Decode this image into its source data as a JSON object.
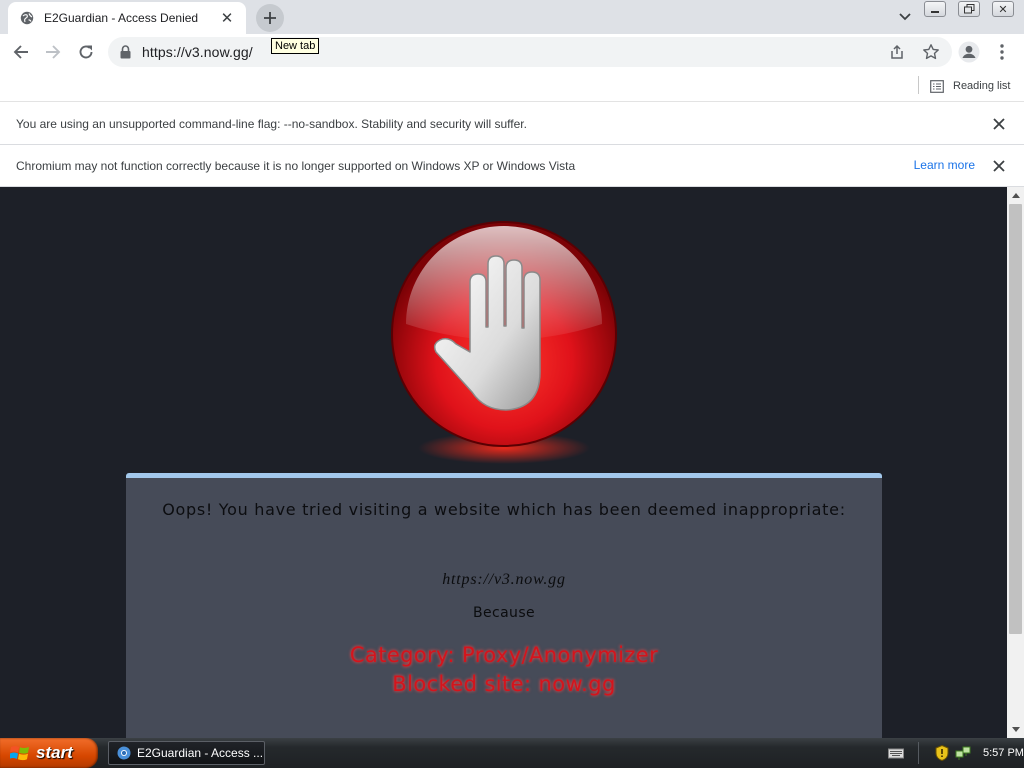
{
  "browser": {
    "tab": {
      "title": "E2Guardian - Access Denied"
    },
    "new_tab_tooltip": "New tab",
    "omnibox": {
      "url": "https://v3.now.gg/"
    },
    "bookmarks": {
      "reading_list_label": "Reading list"
    },
    "infobars": [
      {
        "text": "You are using an unsupported command-line flag: --no-sandbox. Stability and security will suffer."
      },
      {
        "text": "Chromium may not function correctly because it is no longer supported on Windows XP or Windows Vista",
        "link": "Learn more"
      }
    ]
  },
  "page": {
    "heading": "Oops! You have tried visiting a website which has been deemed inappropriate:",
    "blocked_url": "https://v3.now.gg",
    "because_label": "Because",
    "category": "Category: Proxy/Anonymizer",
    "blocked_site": "Blocked site: now.gg",
    "colors": {
      "background": "#1d2028",
      "panel": "#464b58",
      "panel_border": "#a3c8ec",
      "reason_text": "#d4141c",
      "stop_sign": "#e0121a"
    }
  },
  "taskbar": {
    "start_label": "start",
    "task_title": "E2Guardian - Access ...",
    "clock": "5:57 PM"
  }
}
